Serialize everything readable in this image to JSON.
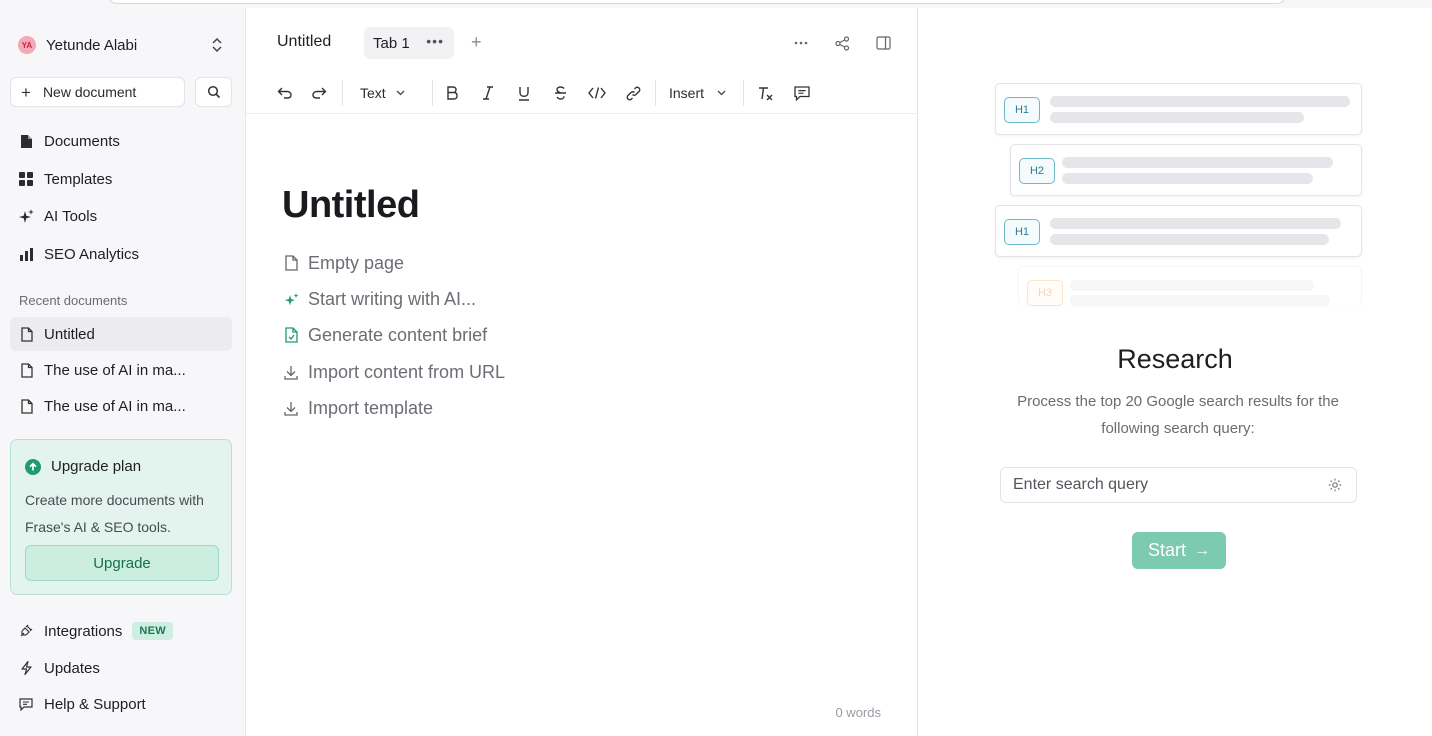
{
  "user": {
    "initials": "YA",
    "name": "Yetunde Alabi"
  },
  "sidebar": {
    "new_document_label": "New document",
    "nav": [
      {
        "label": "Documents",
        "icon": "file-icon"
      },
      {
        "label": "Templates",
        "icon": "grid-icon"
      },
      {
        "label": "AI Tools",
        "icon": "sparkle-icon"
      },
      {
        "label": "SEO Analytics",
        "icon": "bar-chart-icon"
      }
    ],
    "recent_label": "Recent documents",
    "recent": [
      {
        "label": "Untitled",
        "active": true
      },
      {
        "label": "The use of AI in ma...",
        "active": false
      },
      {
        "label": "The use of AI in ma...",
        "active": false
      }
    ],
    "upgrade": {
      "title": "Upgrade plan",
      "text": "Create more documents with Frase's AI & SEO tools.",
      "button": "Upgrade"
    },
    "bottom": [
      {
        "label": "Integrations",
        "icon": "plug-icon",
        "badge": "NEW"
      },
      {
        "label": "Updates",
        "icon": "bolt-icon"
      },
      {
        "label": "Help & Support",
        "icon": "chat-icon"
      }
    ]
  },
  "editor": {
    "doc_tab_title": "Untitled",
    "tab_label": "Tab 1",
    "toolbar": {
      "text_style": "Text",
      "insert": "Insert"
    },
    "heading": "Untitled",
    "options": [
      {
        "label": "Empty page",
        "icon": "file-icon"
      },
      {
        "label": "Start writing with AI...",
        "icon": "sparkle-icon"
      },
      {
        "label": "Generate content brief",
        "icon": "brief-icon"
      },
      {
        "label": "Import content from URL",
        "icon": "download-icon"
      },
      {
        "label": "Import template",
        "icon": "download-icon"
      }
    ],
    "word_count": "0 words"
  },
  "research": {
    "outline_badges": [
      "H1",
      "H2",
      "H1",
      "H3"
    ],
    "title": "Research",
    "description": "Process the top 20 Google search results for the following search query:",
    "search_placeholder": "Enter search query",
    "start_label": "Start"
  },
  "colors": {
    "accent": "#1e9a74",
    "start_button": "#7ccab0",
    "upgrade_bg": "#e3f4ee"
  }
}
